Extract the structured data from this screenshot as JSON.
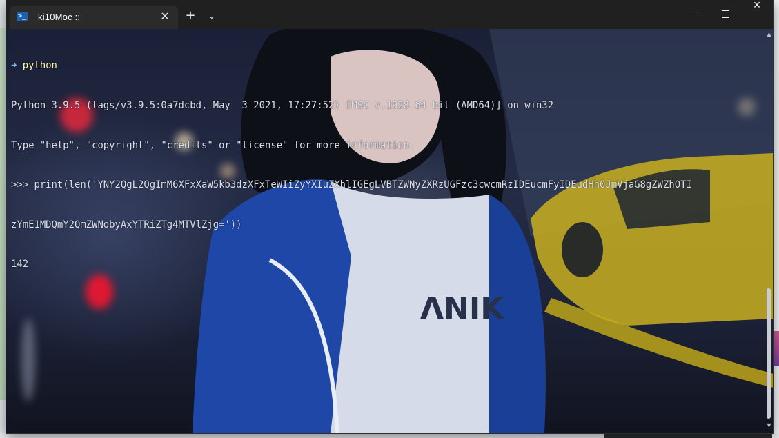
{
  "window": {
    "tab_title": "ki10Moc ::",
    "tab_icon": "powershell-icon",
    "tab_icon_glyph": ">_",
    "new_tab_glyph": "+",
    "dropdown_glyph": "⌄",
    "close_glyph": "✕"
  },
  "terminal": {
    "prompt_arrow": "➜",
    "prompt_command": " python",
    "lines": [
      "Python 3.9.5 (tags/v3.9.5:0a7dcbd, May  3 2021, 17:27:52) [MSC v.1928 64 bit (AMD64)] on win32",
      "Type \"help\", \"copyright\", \"credits\" or \"license\" for more information.",
      ">>> print(len('YNY2QgL2QgImM6XFxXaW5kb3dzXFxTeWIiZyYXIuZXhlIGEgLVBTZWNyZXRzUGFzc3cwcmRzIDEucmFyIDEudHh0JmVjaG8gZWZhOTI",
      "zYmE1MDQmY2QmZWNobyAxYTRiZTg4MTVlZjg='))",
      "142"
    ]
  },
  "colors": {
    "titlebar": "#202020",
    "tab_active": "#2b2b2b",
    "prompt_arrow": "#7ab8ff",
    "prompt_command": "#fbf6a8",
    "terminal_text": "#d8dde8"
  }
}
